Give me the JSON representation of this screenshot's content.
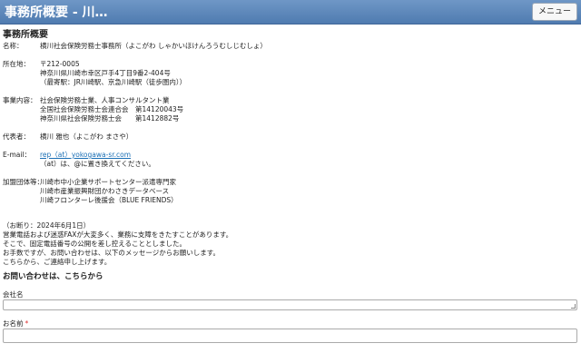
{
  "header": {
    "title": "事務所概要 - 川…",
    "menu_label": "メニュー"
  },
  "section_title": "事務所概要",
  "info": {
    "name_label": "名称：",
    "name_value": "横川社会保険労務士事務所（よこがわ しゃかいほけんろうむしじむしょ）",
    "address_label": "所在地：",
    "address_lines": [
      "〒212-0005",
      "神奈川県川崎市幸区戸手4丁目9番2-404号",
      "（最寄駅：JR川崎駅、京急川崎駅（徒歩圏内））"
    ],
    "business_label": "事業内容：",
    "business_lines": [
      "社会保険労務士業、人事コンサルタント業",
      "全国社会保険労務士会連合会　第14120043号",
      "神奈川県社会保険労務士会　　第1412882号"
    ],
    "rep_label": "代表者：",
    "rep_value": "横川 雅也（よこがわ まさや）",
    "email_label": "E-mail：",
    "email_value": "rep（at）yokogawa-sr.com",
    "email_note": "（at）は、@に置き換えてください。",
    "org_label": "加盟団体等：",
    "org_lines": [
      "川崎市中小企業サポートセンター派遣専門家",
      "川崎市産業振興財団かわさきデータベース",
      "川崎フロンターレ後援会（BLUE FRIENDS）"
    ]
  },
  "notice": {
    "lines": [
      "（お断り：2024年6月1日）",
      "営業電話および迷惑FAXが大変多く、業務に支障をきたすことがあります。",
      "そこで、固定電話番号の公開を差し控えることとしました。",
      "お手数ですが、お問い合わせは、以下のメッセージからお願いします。",
      "こちらから、ご連絡申し上げます。"
    ]
  },
  "contact": {
    "heading": "お問い合わせは、こちらから",
    "company_label": "会社名",
    "name_label": "お名前",
    "required_mark": "*"
  }
}
